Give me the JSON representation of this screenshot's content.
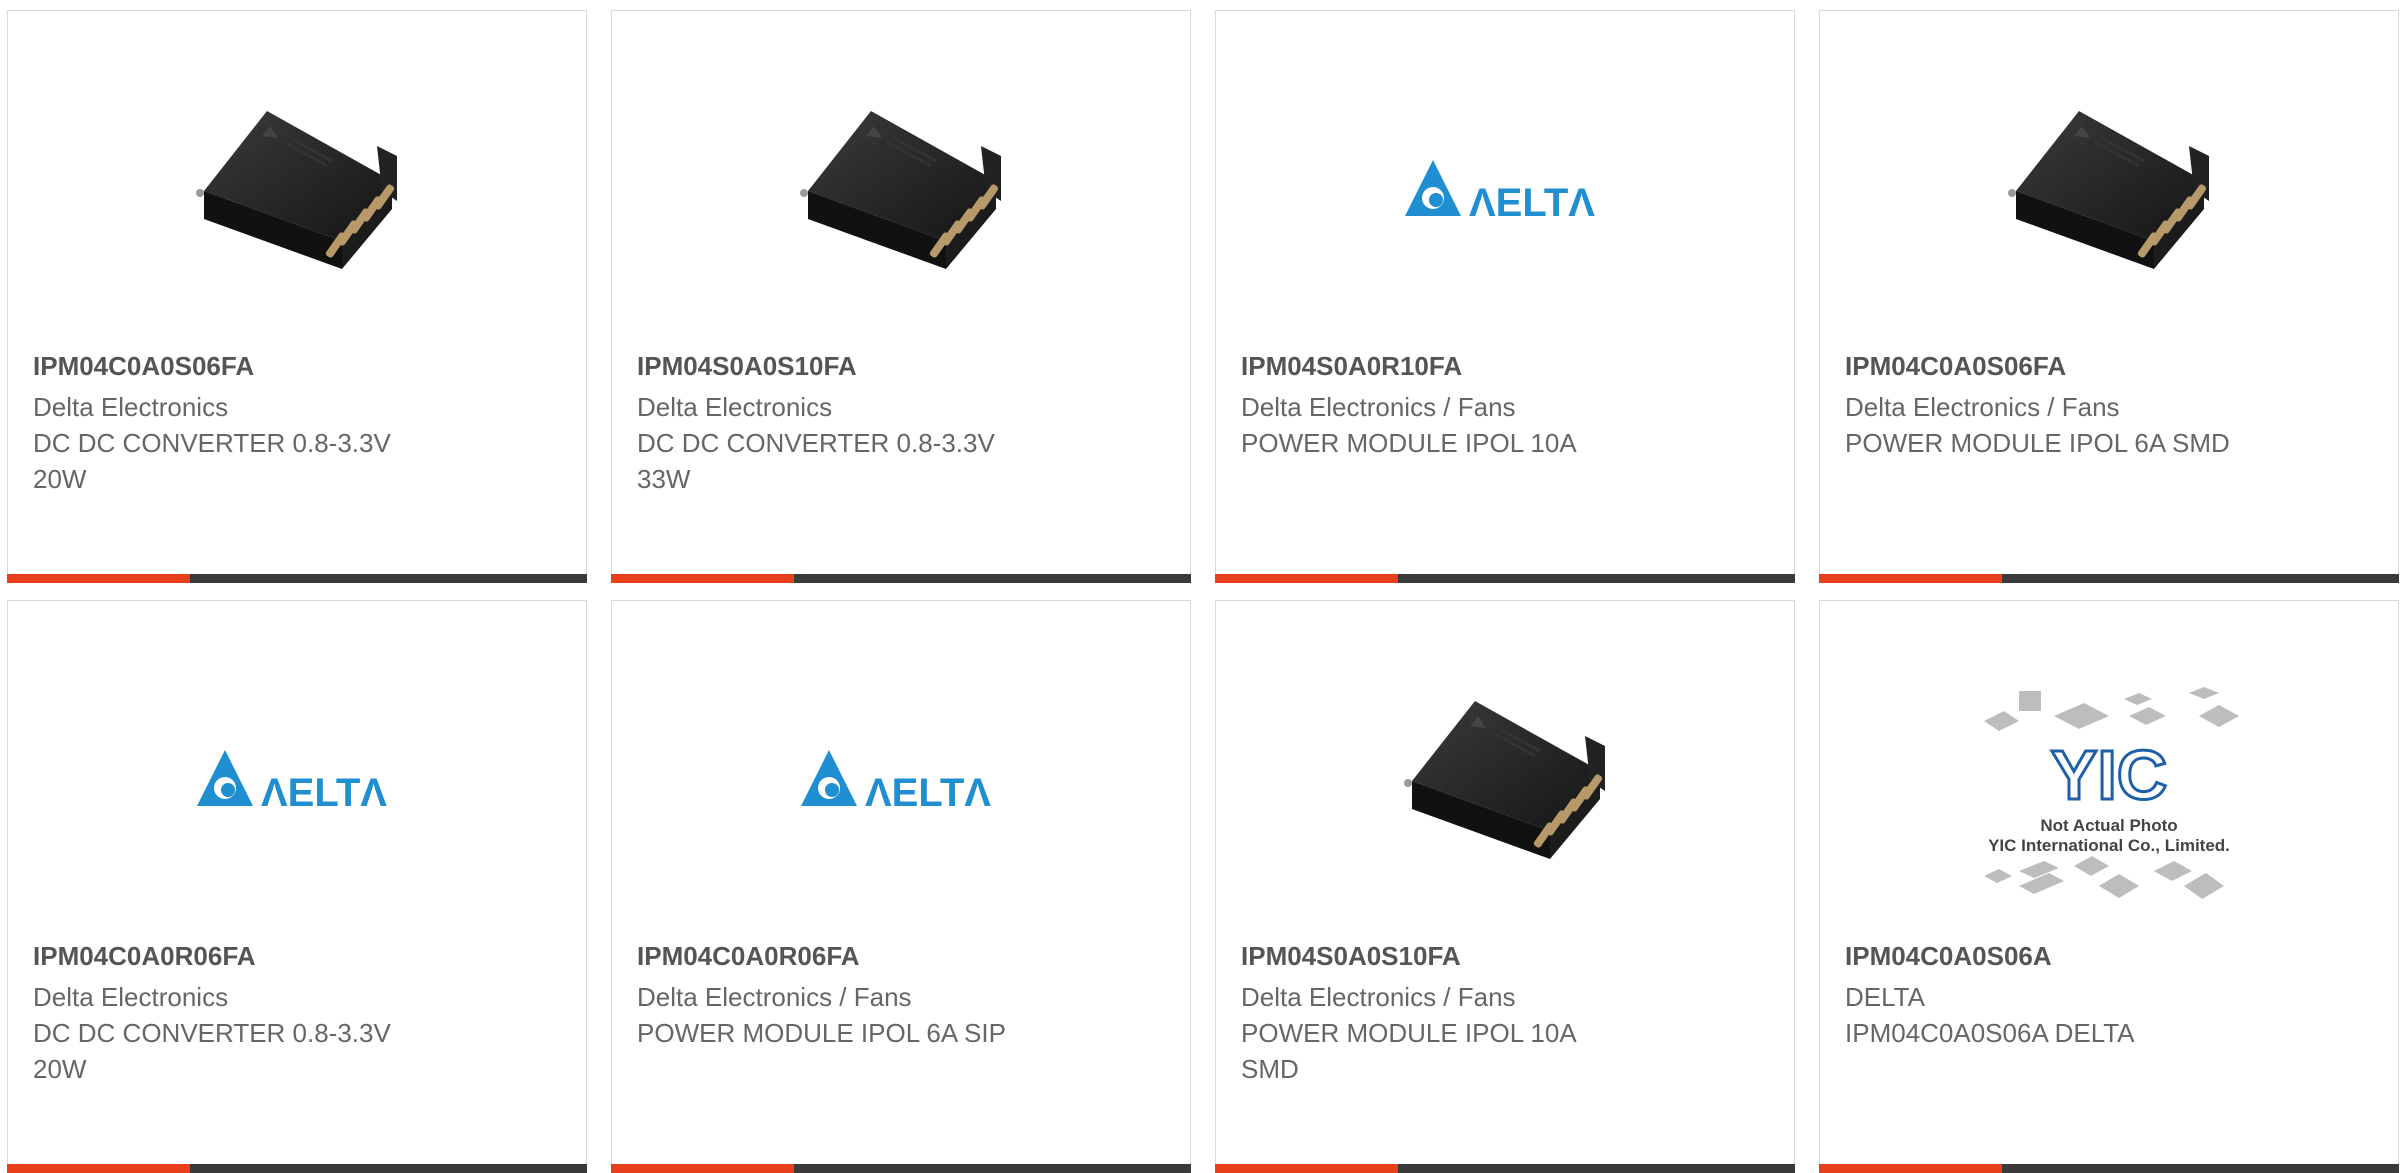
{
  "accent_color": "#e8401c",
  "bar_color": "#3a3a3a",
  "delta_blue": "#1f8fd1",
  "cards": [
    {
      "image": "chip-photo",
      "part": "IPM04C0A0S06FA",
      "maker": "Delta Electronics",
      "desc": "DC DC CONVERTER 0.8-3.3V\n20W"
    },
    {
      "image": "chip-photo",
      "part": "IPM04S0A0S10FA",
      "maker": "Delta Electronics",
      "desc": "DC DC CONVERTER 0.8-3.3V\n33W"
    },
    {
      "image": "delta-logo",
      "part": "IPM04S0A0R10FA",
      "maker": "Delta Electronics / Fans",
      "desc": "POWER MODULE IPOL 10A"
    },
    {
      "image": "chip-photo",
      "part": "IPM04C0A0S06FA",
      "maker": "Delta Electronics / Fans",
      "desc": "POWER MODULE IPOL 6A SMD"
    },
    {
      "image": "delta-logo",
      "part": "IPM04C0A0R06FA",
      "maker": "Delta Electronics",
      "desc": "DC DC CONVERTER 0.8-3.3V\n20W"
    },
    {
      "image": "delta-logo",
      "part": "IPM04C0A0R06FA",
      "maker": "Delta Electronics / Fans",
      "desc": "POWER MODULE IPOL 6A SIP"
    },
    {
      "image": "chip-photo",
      "part": "IPM04S0A0S10FA",
      "maker": "Delta Electronics / Fans",
      "desc": "POWER MODULE IPOL 10A\nSMD"
    },
    {
      "image": "yic-placeholder",
      "part": "IPM04C0A0S06A",
      "maker": "DELTA",
      "desc": "IPM04C0A0S06A DELTA"
    }
  ],
  "yic_placeholder": {
    "line1": "Not Actual Photo",
    "line2": "YIC International Co., Limited."
  }
}
